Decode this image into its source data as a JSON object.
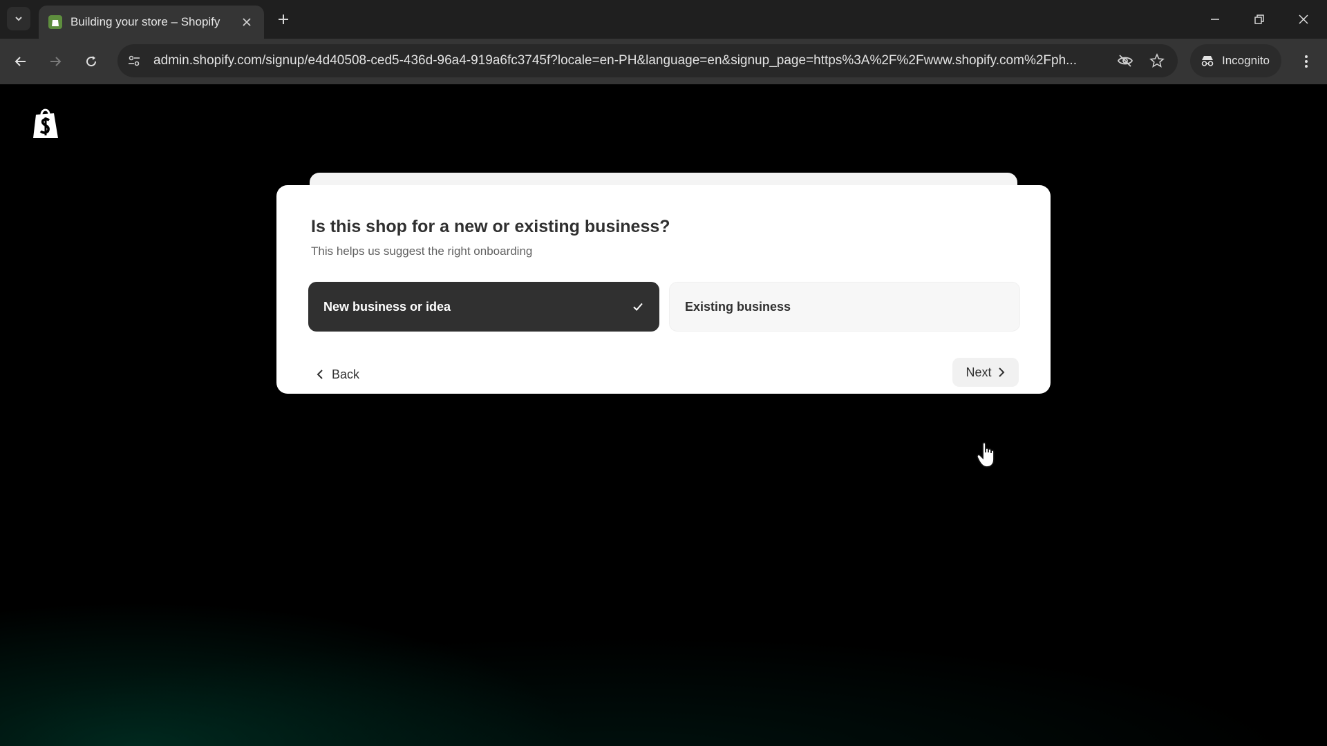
{
  "browser": {
    "tab": {
      "title": "Building your store – Shopify",
      "favicon": "shopify-icon"
    },
    "url": "admin.shopify.com/signup/e4d40508-ced5-436d-96a4-919a6fc3745f?locale=en-PH&language=en&signup_page=https%3A%2F%2Fwww.shopify.com%2Fph...",
    "incognito_label": "Incognito",
    "icons": [
      "tab-search-icon",
      "close-icon",
      "plus-icon",
      "minimize-icon",
      "restore-icon",
      "close-window-icon",
      "back-arrow-icon",
      "forward-arrow-icon",
      "reload-icon",
      "site-settings-icon",
      "eye-off-icon",
      "star-icon",
      "incognito-icon",
      "more-vert-icon"
    ]
  },
  "page": {
    "logo": "shopify-logo",
    "question": {
      "title": "Is this shop for a new or existing business?",
      "subtitle": "This helps us suggest the right onboarding"
    },
    "options": [
      {
        "label": "New business or idea",
        "selected": true
      },
      {
        "label": "Existing business",
        "selected": false
      }
    ],
    "back_label": "Back",
    "next_label": "Next"
  },
  "colors": {
    "selected_option_bg": "#303030",
    "card_bg": "#ffffff",
    "page_bg": "#000000",
    "shopify_green": "#5e8e3e"
  }
}
